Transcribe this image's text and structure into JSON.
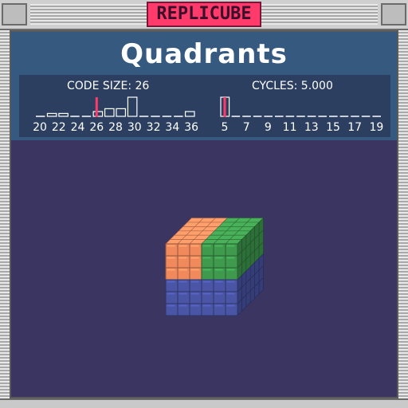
{
  "window": {
    "app_title": "REPLICUBE",
    "colors": {
      "accent": "#ff3b6b",
      "header": "#35597f",
      "background": "#3b3561"
    }
  },
  "puzzle": {
    "title": "Quadrants"
  },
  "stats": {
    "code_size_label": "CODE SIZE: 26",
    "cycles_label": "CYCLES: 5.000",
    "code_size": {
      "ticks": [
        "20",
        "22",
        "24",
        "26",
        "28",
        "30",
        "32",
        "34",
        "36"
      ],
      "bars": [
        0.08,
        0.15,
        0.15,
        0.08,
        0.08,
        0.25,
        0.4,
        0.4,
        1.0,
        0.08,
        0.08,
        0.08,
        0.08,
        0.25
      ],
      "marker": 26,
      "marker_color": "#ff3b6b"
    },
    "cycles": {
      "ticks": [
        "5",
        "7",
        "9",
        "11",
        "13",
        "15",
        "17",
        "19"
      ],
      "bars": [
        1.0,
        0.08,
        0.08,
        0.08,
        0.08,
        0.08,
        0.08,
        0.08,
        0.08,
        0.08,
        0.08,
        0.08,
        0.08,
        0.08,
        0.08
      ],
      "marker": 5,
      "marker_color": "#ff3b6b"
    }
  },
  "cube": {
    "size": 6,
    "colors": {
      "orange": "#f08a5d",
      "green": "#3f9a4e",
      "blue": "#4a55a6"
    }
  }
}
